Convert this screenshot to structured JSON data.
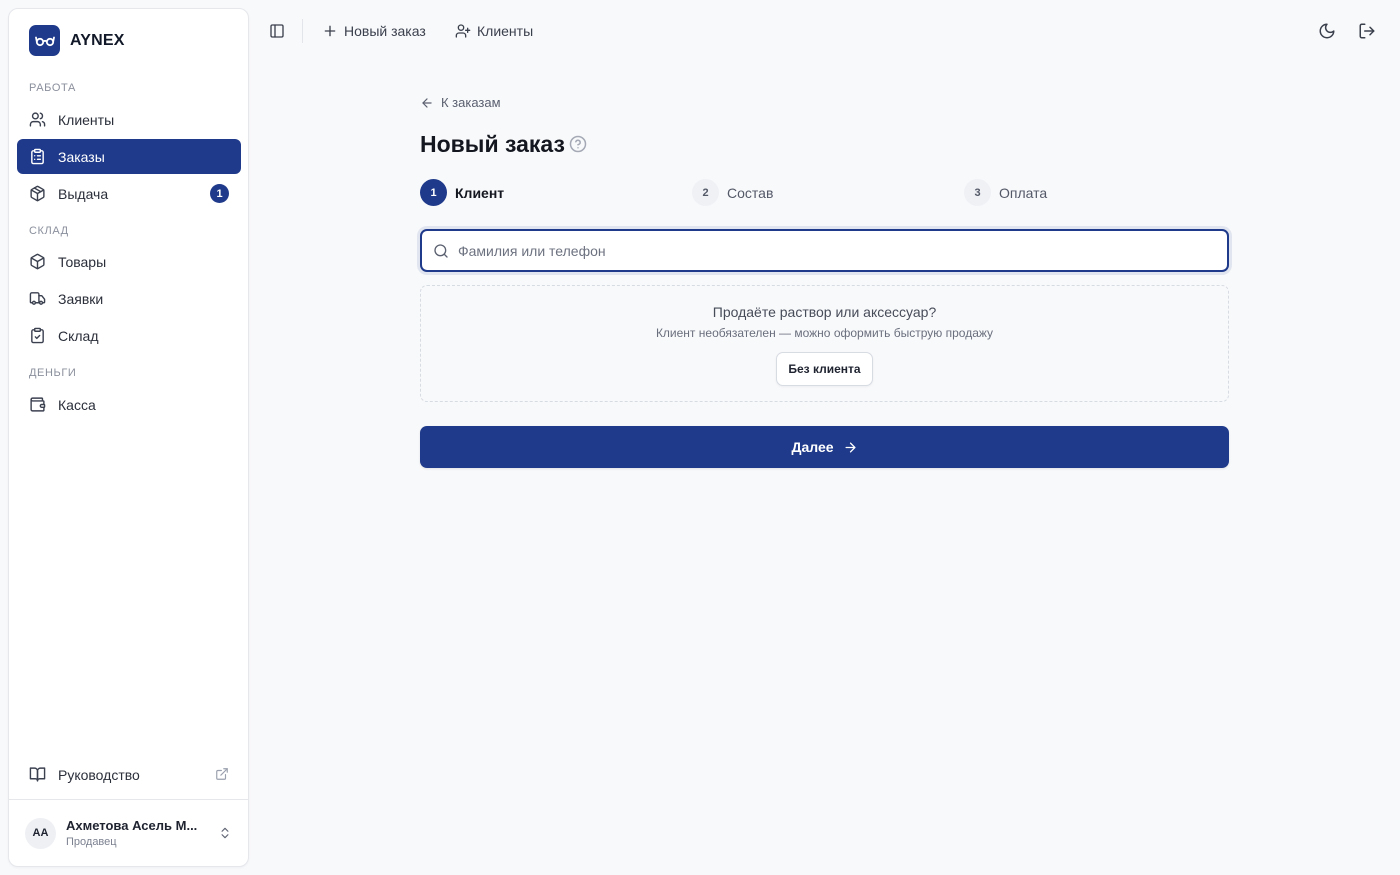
{
  "brand": {
    "name": "AYNEX",
    "logo_icon": "glasses-icon"
  },
  "colors": {
    "accent": "#1f3a8a",
    "background": "#f8f9fb",
    "sidebar_bg": "#ffffff"
  },
  "sidebar": {
    "sections": [
      {
        "label": "РАБОТА"
      },
      {
        "label": "СКЛАД"
      },
      {
        "label": "ДЕНЬГИ"
      }
    ],
    "items": [
      {
        "label": "Клиенты",
        "icon": "users-icon"
      },
      {
        "label": "Заказы",
        "icon": "clipboard-list-icon",
        "active": true
      },
      {
        "label": "Выдача",
        "icon": "package-icon",
        "badge": "1"
      },
      {
        "label": "Товары",
        "icon": "box-icon"
      },
      {
        "label": "Заявки",
        "icon": "truck-icon"
      },
      {
        "label": "Склад",
        "icon": "clipboard-check-icon"
      },
      {
        "label": "Касса",
        "icon": "wallet-icon"
      }
    ],
    "guide": {
      "label": "Руководство",
      "icon": "book-open-icon"
    },
    "user": {
      "initials": "АА",
      "name": "Ахметова Асель М...",
      "role": "Продавец"
    }
  },
  "topbar": {
    "new_order": "Новый заказ",
    "clients": "Клиенты"
  },
  "main": {
    "back_link": "К заказам",
    "title": "Новый заказ",
    "steps": [
      {
        "number": "1",
        "label": "Клиент",
        "active": true
      },
      {
        "number": "2",
        "label": "Состав"
      },
      {
        "number": "3",
        "label": "Оплата"
      }
    ],
    "search": {
      "placeholder": "Фамилия или телефон",
      "value": ""
    },
    "no_client": {
      "title": "Продаёте раствор или аксессуар?",
      "subtitle": "Клиент необязателен — можно оформить быструю продажу",
      "button": "Без клиента"
    },
    "next_button": "Далее"
  }
}
